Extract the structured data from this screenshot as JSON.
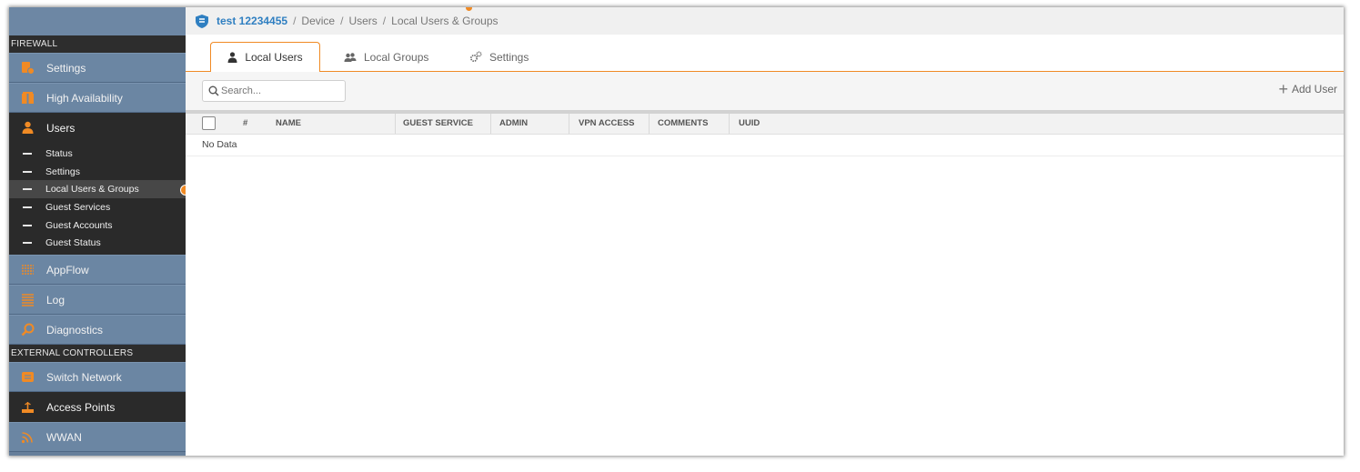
{
  "sidebar": {
    "section_firewall": "FIREWALL",
    "section_external": "EXTERNAL CONTROLLERS",
    "items": {
      "settings": "Settings",
      "high_availability": "High Availability",
      "users": "Users",
      "appflow": "AppFlow",
      "log": "Log",
      "diagnostics": "Diagnostics",
      "switch_network": "Switch Network",
      "access_points": "Access Points",
      "wwan": "WWAN"
    },
    "users_sub": [
      "Status",
      "Settings",
      "Local Users & Groups",
      "Guest Services",
      "Guest Accounts",
      "Guest Status"
    ]
  },
  "breadcrumb": {
    "device_name": "test 12234455",
    "parts": [
      "Device",
      "Users",
      "Local Users & Groups"
    ],
    "separator": "/"
  },
  "tabs": {
    "local_users": "Local Users",
    "local_groups": "Local Groups",
    "settings": "Settings"
  },
  "toolbar": {
    "search_placeholder": "Search...",
    "add_user": "Add User"
  },
  "table": {
    "columns": [
      "#",
      "NAME",
      "GUEST SERVICE",
      "ADMIN",
      "VPN ACCESS",
      "COMMENTS",
      "UUID"
    ],
    "empty_text": "No Data"
  },
  "colors": {
    "accent": "#f08a24",
    "sidebar": "#6b86a3",
    "sidebar_dark": "#2a2a2a",
    "link": "#2f7fc1"
  }
}
